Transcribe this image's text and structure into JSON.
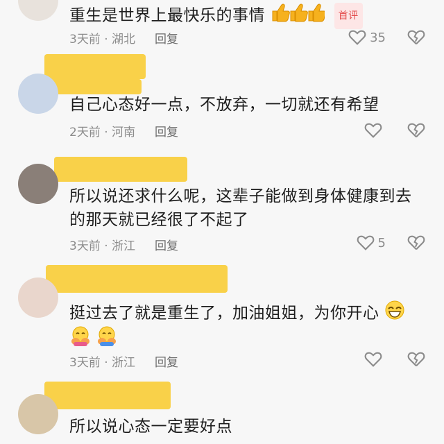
{
  "comments": [
    {
      "text": "重生是世界上最快乐的事情",
      "badge": "首评",
      "time": "3天前",
      "location": "湖北",
      "reply": "回复",
      "likes": "35",
      "emoji": "thumbs-up x3"
    },
    {
      "text": "自己心态好一点，不放弃，一切就还有希望",
      "time": "2天前",
      "location": "河南",
      "reply": "回复",
      "likes": ""
    },
    {
      "text": "所以说还求什么呢，这辈子能做到身体健康到去的那天就已经很了不起了",
      "time": "3天前",
      "location": "浙江",
      "reply": "回复",
      "likes": "5"
    },
    {
      "text": "挺过去了就是重生了，加油姐姐，为你开心",
      "time": "3天前",
      "location": "浙江",
      "reply": "回复",
      "likes": "",
      "emoji": "grin, hug x2"
    },
    {
      "text": "所以说心态一定要好点",
      "time": "",
      "location": "",
      "reply": "",
      "likes": ""
    }
  ],
  "colors": {
    "redaction": "#f9cf3f",
    "meta": "#8b8b8b",
    "badge": "#e34b4b",
    "background": "#f7f7f7"
  },
  "icons": {
    "like": "heart-outline-icon",
    "dislike": "broken-heart-icon",
    "thumbs_up": "thumbs-up-emoji",
    "grin": "grin-emoji",
    "hug": "hug-emoji"
  }
}
